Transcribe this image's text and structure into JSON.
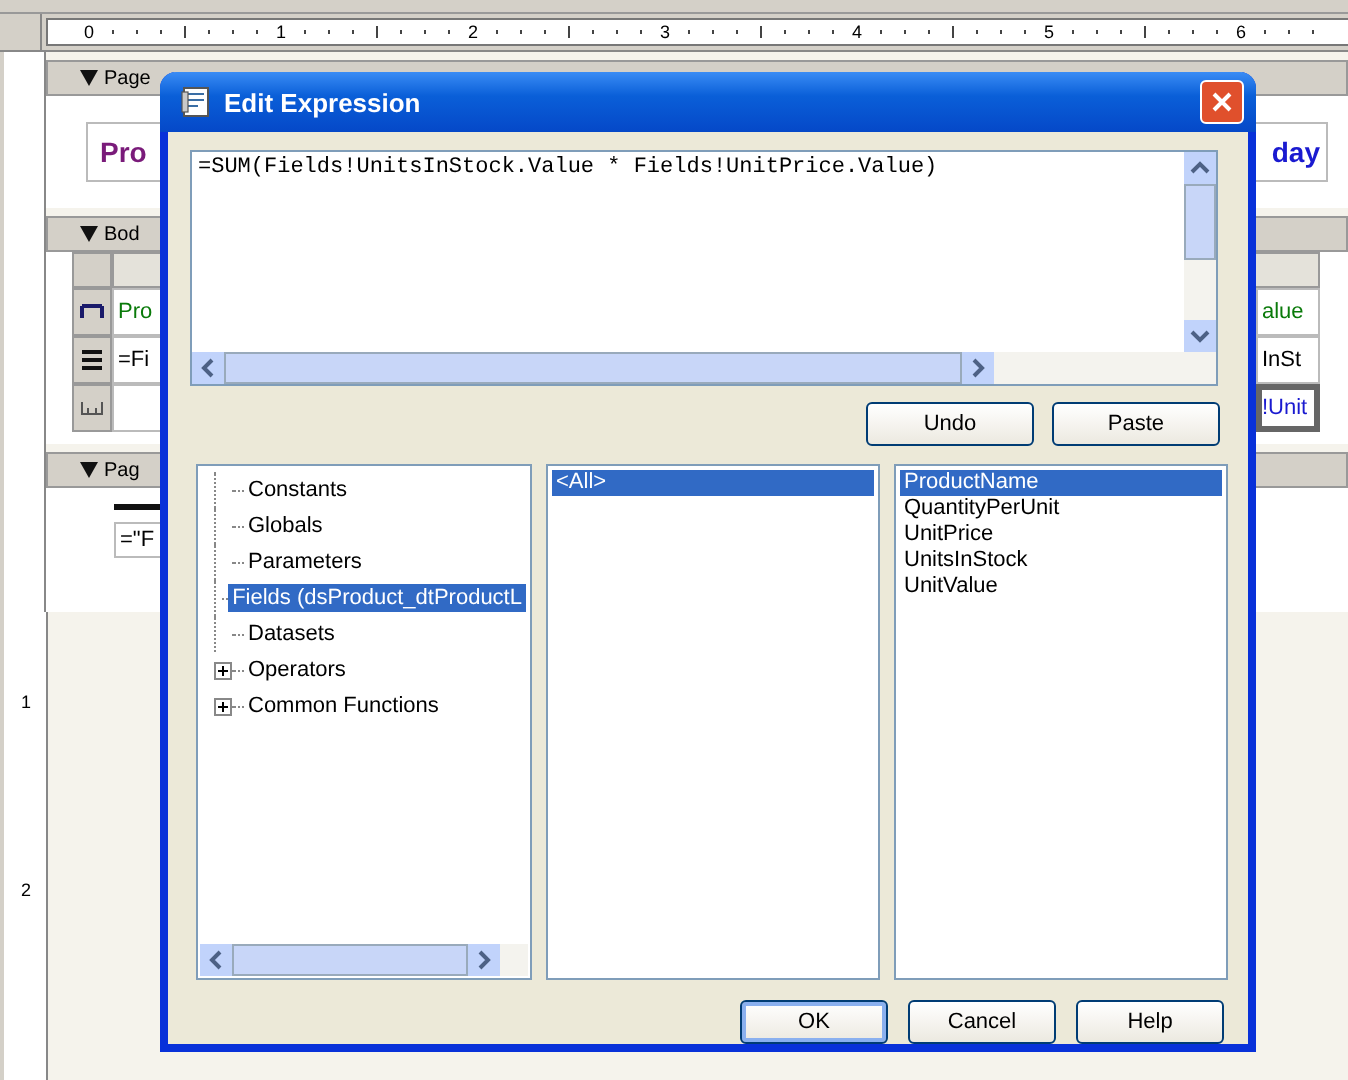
{
  "designer": {
    "ruler": [
      "0",
      "1",
      "2",
      "3",
      "4",
      "5",
      "6"
    ],
    "page_header": {
      "label": "Page",
      "title_start": "Pro",
      "title_end": "day"
    },
    "body": {
      "label": "Bod",
      "rows": [
        {
          "kind": "header",
          "left": "Pro",
          "right": "alue",
          "selected": false
        },
        {
          "kind": "detail",
          "left": "=Fi",
          "right": "InSt",
          "selected": false
        },
        {
          "kind": "footer",
          "right": "!Unit",
          "selected": true
        }
      ]
    },
    "page_footer": {
      "label": "Pag",
      "text": "=\"F"
    },
    "vertical_ruler": [
      "1",
      "2"
    ]
  },
  "dialog": {
    "title": "Edit Expression",
    "expression": "=SUM(Fields!UnitsInStock.Value * Fields!UnitPrice.Value)",
    "edit_buttons": [
      "Undo",
      "Paste"
    ],
    "tree": [
      {
        "label": "Constants",
        "expandable": false,
        "selected": false
      },
      {
        "label": "Globals",
        "expandable": false,
        "selected": false
      },
      {
        "label": "Parameters",
        "expandable": false,
        "selected": false
      },
      {
        "label": "Fields (dsProduct_dtProductL",
        "expandable": false,
        "selected": true
      },
      {
        "label": "Datasets",
        "expandable": false,
        "selected": false
      },
      {
        "label": "Operators",
        "expandable": true,
        "selected": false
      },
      {
        "label": "Common Functions",
        "expandable": true,
        "selected": false
      }
    ],
    "categories": [
      {
        "label": "<All>",
        "selected": true
      }
    ],
    "items": [
      {
        "label": "ProductName",
        "selected": true
      },
      {
        "label": "QuantityPerUnit",
        "selected": false
      },
      {
        "label": "UnitPrice",
        "selected": false
      },
      {
        "label": "UnitsInStock",
        "selected": false
      },
      {
        "label": "UnitValue",
        "selected": false
      }
    ],
    "buttons": [
      {
        "label": "OK",
        "default": true
      },
      {
        "label": "Cancel",
        "default": false
      },
      {
        "label": "Help",
        "default": false
      }
    ]
  }
}
